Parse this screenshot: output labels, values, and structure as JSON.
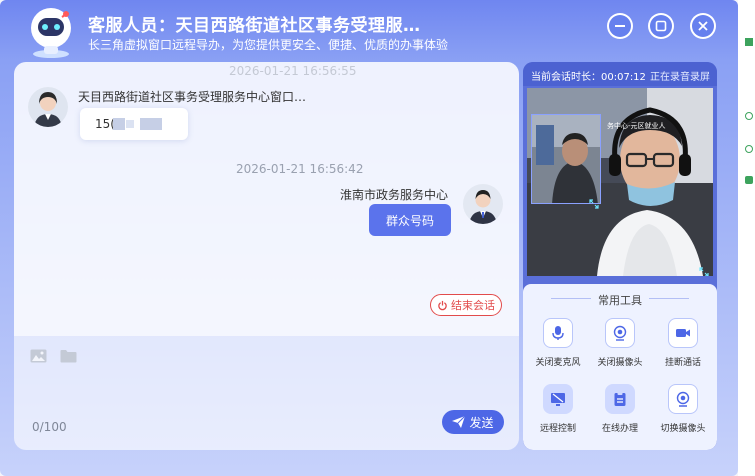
{
  "header": {
    "title": "客服人员：天目西路街道社区事务受理服…",
    "subtitle": "长三角虚拟窗口远程导办，为您提供更安全、便捷、优质的办事体验"
  },
  "window_controls": [
    "minimize-icon",
    "maximize-icon",
    "close-icon"
  ],
  "chat": {
    "previous_timestamp_partial": "2026-01-21 16:56:55",
    "agent_message": {
      "sender": "天目西路街道社区事务受理服务中心窗口…",
      "text_visible_prefix": "15("
    },
    "timestamp": "2026-01-21 16:56:42",
    "user_message": {
      "sender": "淮南市政务服务中心",
      "text": "群众号码"
    },
    "end_session_label": "结束会话"
  },
  "input": {
    "icons": [
      "image-icon",
      "folder-icon"
    ],
    "counter": "0/100",
    "send_label": "发送"
  },
  "session": {
    "duration": "当前会话时长：00:07:12",
    "recording_status": "正在录音录屏",
    "video_caption": "务中心-元区就业人"
  },
  "tools": {
    "title": "常用工具",
    "items": [
      {
        "label": "关闭麦克风",
        "icon": "microphone-icon"
      },
      {
        "label": "关闭摄像头",
        "icon": "camera-icon"
      },
      {
        "label": "挂断通话",
        "icon": "video-call-icon"
      },
      {
        "label": "远程控制",
        "icon": "remote-control-icon"
      },
      {
        "label": "在线办理",
        "icon": "clipboard-icon"
      },
      {
        "label": "切换摄像头",
        "icon": "switch-camera-icon"
      }
    ]
  },
  "colors": {
    "accent": "#5b73ec",
    "end_session": "#e24b4b",
    "header_gradient_start": "#6f86f0"
  }
}
